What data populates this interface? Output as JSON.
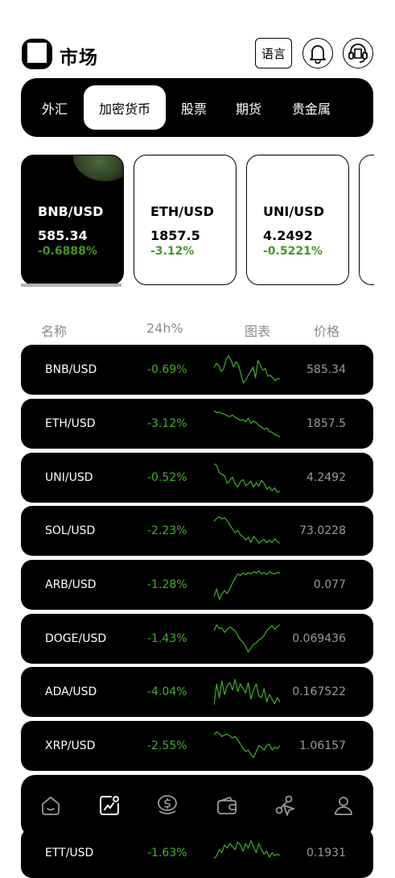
{
  "header": {
    "title": "市场",
    "language_label": "语言",
    "icons": [
      "logo-icon",
      "bell-icon",
      "support-icon"
    ]
  },
  "tabs": [
    {
      "label": "外汇",
      "active": false
    },
    {
      "label": "加密货币",
      "active": true
    },
    {
      "label": "股票",
      "active": false
    },
    {
      "label": "期货",
      "active": false
    },
    {
      "label": "贵金属",
      "active": false
    }
  ],
  "cards": [
    {
      "pair": "BNB/USD",
      "price": "585.34",
      "change": "-0.6888%",
      "selected": true
    },
    {
      "pair": "ETH/USD",
      "price": "1857.5",
      "change": "-3.12%",
      "selected": false
    },
    {
      "pair": "UNI/USD",
      "price": "4.2492",
      "change": "-0.5221%",
      "selected": false
    }
  ],
  "columns": {
    "name": "名称",
    "change": "24h%",
    "chart": "图表",
    "price": "价格"
  },
  "rows": [
    {
      "symbol": "BNB/USD",
      "change": "-0.69%",
      "price": "585.34",
      "spark": [
        20,
        14,
        17,
        25,
        21,
        8,
        4,
        10,
        19,
        12,
        16,
        28,
        40,
        36,
        30,
        25,
        19,
        33,
        10,
        17,
        23,
        21,
        31,
        30,
        33,
        37,
        34,
        35
      ]
    },
    {
      "symbol": "ETH/USD",
      "change": "-3.12%",
      "price": "1857.5",
      "spark": [
        5,
        8,
        7,
        9,
        10,
        12,
        13,
        11,
        14,
        16,
        18,
        17,
        20,
        15,
        22,
        19,
        21,
        25,
        27,
        30,
        28,
        33,
        34,
        37,
        38,
        40
      ]
    },
    {
      "symbol": "UNI/USD",
      "change": "-0.52%",
      "price": "4.2492",
      "spark": [
        4,
        6,
        16,
        18,
        20,
        30,
        26,
        22,
        30,
        35,
        28,
        25,
        33,
        31,
        27,
        35,
        29,
        34,
        26,
        30,
        38,
        35,
        40,
        36,
        42,
        41
      ]
    },
    {
      "symbol": "SOL/USD",
      "change": "-2.23%",
      "price": "73.0228",
      "spark": [
        10,
        6,
        4,
        7,
        5,
        9,
        15,
        20,
        25,
        22,
        28,
        30,
        35,
        31,
        38,
        30,
        34,
        39,
        36,
        34,
        38,
        35,
        38,
        33,
        37,
        39
      ]
    },
    {
      "symbol": "ARB/USD",
      "change": "-1.28%",
      "price": "0.077",
      "spark": [
        38,
        28,
        42,
        35,
        30,
        34,
        28,
        20,
        14,
        8,
        10,
        7,
        9,
        6,
        8,
        5,
        7,
        4,
        8,
        6,
        9,
        5,
        7,
        8,
        6,
        7
      ]
    },
    {
      "symbol": "DOGE/USD",
      "change": "-1.43%",
      "price": "0.069436",
      "spark": [
        12,
        4,
        9,
        8,
        14,
        10,
        7,
        9,
        12,
        18,
        24,
        27,
        33,
        40,
        35,
        30,
        28,
        24,
        22,
        18,
        12,
        8,
        5,
        10,
        6,
        4
      ]
    },
    {
      "symbol": "ADA/USD",
      "change": "-4.04%",
      "price": "0.167522",
      "spark": [
        40,
        12,
        30,
        8,
        26,
        14,
        10,
        20,
        6,
        22,
        12,
        18,
        24,
        10,
        32,
        20,
        12,
        28,
        30,
        18,
        36,
        26,
        32,
        38,
        30,
        36
      ]
    },
    {
      "symbol": "XRP/USD",
      "change": "-2.55%",
      "price": "1.06157",
      "spark": [
        8,
        4,
        6,
        10,
        8,
        7,
        9,
        12,
        10,
        14,
        20,
        26,
        30,
        28,
        34,
        38,
        30,
        22,
        24,
        28,
        22,
        20,
        28,
        24,
        26,
        22
      ]
    },
    {
      "symbol": "ETT/USD",
      "change": "-1.63%",
      "price": "0.1931",
      "spark": [
        30,
        26,
        18,
        22,
        12,
        16,
        10,
        14,
        18,
        8,
        12,
        20,
        10,
        16,
        6,
        14,
        22,
        10,
        18,
        24,
        20,
        28,
        22,
        26,
        24,
        26
      ]
    }
  ],
  "bottom_nav": [
    {
      "icon": "home-icon",
      "active": false
    },
    {
      "icon": "market-chart-icon",
      "active": true
    },
    {
      "icon": "coin-icon",
      "active": false
    },
    {
      "icon": "wallet-icon",
      "active": false
    },
    {
      "icon": "share-icon",
      "active": false
    },
    {
      "icon": "profile-icon",
      "active": false
    }
  ],
  "colors": {
    "accent_green": "#42b02a",
    "background": "#ffffff",
    "panel": "#000000"
  }
}
